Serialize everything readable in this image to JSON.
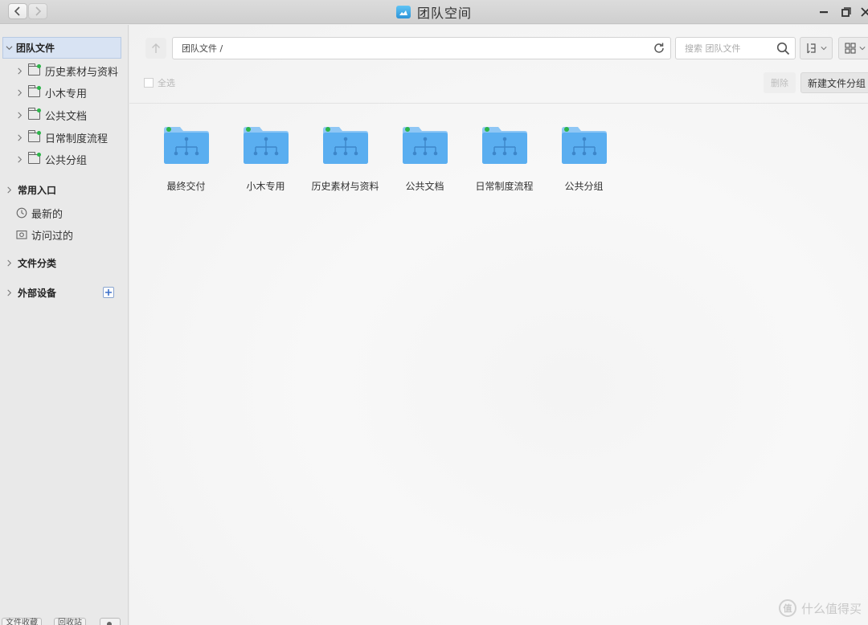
{
  "window": {
    "title": "团队空间"
  },
  "sidebar": {
    "root_label": "团队文件",
    "tree": [
      {
        "label": "历史素材与资料"
      },
      {
        "label": "小木专用"
      },
      {
        "label": "公共文档"
      },
      {
        "label": "日常制度流程"
      },
      {
        "label": "公共分组"
      }
    ],
    "sections": {
      "common": {
        "label": "常用入口",
        "items": [
          {
            "label": "最新的",
            "icon": "clock-icon"
          },
          {
            "label": "访问过的",
            "icon": "visited-icon"
          }
        ]
      },
      "categories": {
        "label": "文件分类"
      },
      "devices": {
        "label": "外部设备",
        "add_icon": "plus-icon"
      }
    },
    "bottom_tabs": [
      "文件收藏",
      "回收站"
    ]
  },
  "toolbar": {
    "path": "团队文件 /",
    "search_placeholder": "搜索 团队文件",
    "select_all": "全选",
    "delete_label": "删除",
    "new_group_label": "新建文件分组"
  },
  "folders": [
    {
      "label": "最终交付"
    },
    {
      "label": "小木专用"
    },
    {
      "label": "历史素材与资料"
    },
    {
      "label": "公共文档"
    },
    {
      "label": "日常制度流程"
    },
    {
      "label": "公共分组"
    }
  ],
  "watermark": {
    "icon_text": "值",
    "text": "什么值得买"
  },
  "colors": {
    "folder_blue": "#5aaef0",
    "folder_dot": "#2db54a",
    "selection_bg": "#d8e3f3"
  }
}
